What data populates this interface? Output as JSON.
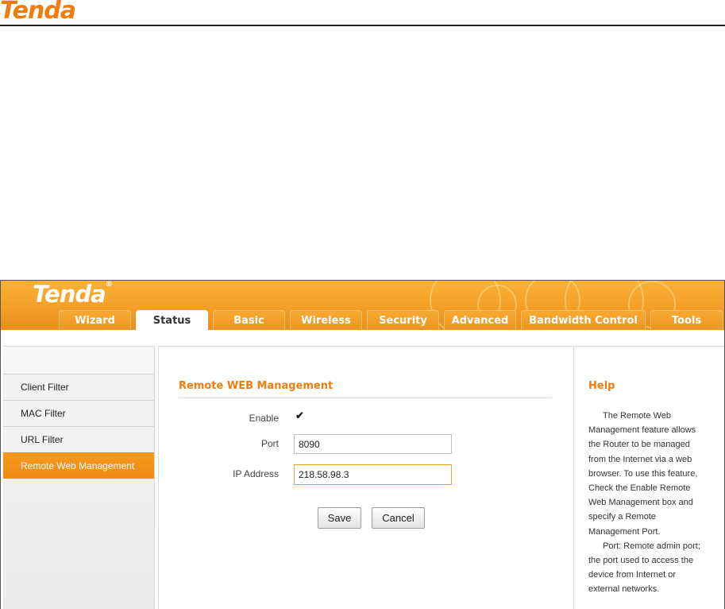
{
  "doc_header": {
    "logo": "Tenda"
  },
  "ui": {
    "logo": "Tenda",
    "logo_mark": "®",
    "tabs": [
      {
        "label": "Wizard"
      },
      {
        "label": "Status"
      },
      {
        "label": "Basic"
      },
      {
        "label": "Wireless"
      },
      {
        "label": "Security"
      },
      {
        "label": "Advanced"
      },
      {
        "label": "Bandwidth Control"
      },
      {
        "label": "Tools"
      }
    ],
    "active_tab": "Status",
    "sidebar": {
      "items": [
        {
          "label": "Client Filter"
        },
        {
          "label": "MAC Filter"
        },
        {
          "label": "URL Filter"
        },
        {
          "label": "Remote Web Management"
        }
      ],
      "active_item": "Remote Web Management"
    },
    "main": {
      "title": "Remote WEB Management",
      "enable_label": "Enable",
      "enable_checked": true,
      "enable_mark": "✔",
      "port_label": "Port",
      "port_value": "8090",
      "ip_label": "IP Address",
      "ip_value": "218.58.98.3",
      "save_label": "Save",
      "cancel_label": "Cancel"
    },
    "help": {
      "title": "Help",
      "paragraph_1": "The Remote Web Management feature allows the Router to be managed from the Internet via a web browser. To use this feature, Check the Enable Remote Web Management box and specify a Remote Management Port.",
      "paragraph_2": "Port: Remote admin port; the port used to access the device from Internet or external networks."
    },
    "colors": {
      "accent": "#f07c0e",
      "banner": "#f5a22b",
      "active_sidebar": "#f59a1d"
    }
  }
}
